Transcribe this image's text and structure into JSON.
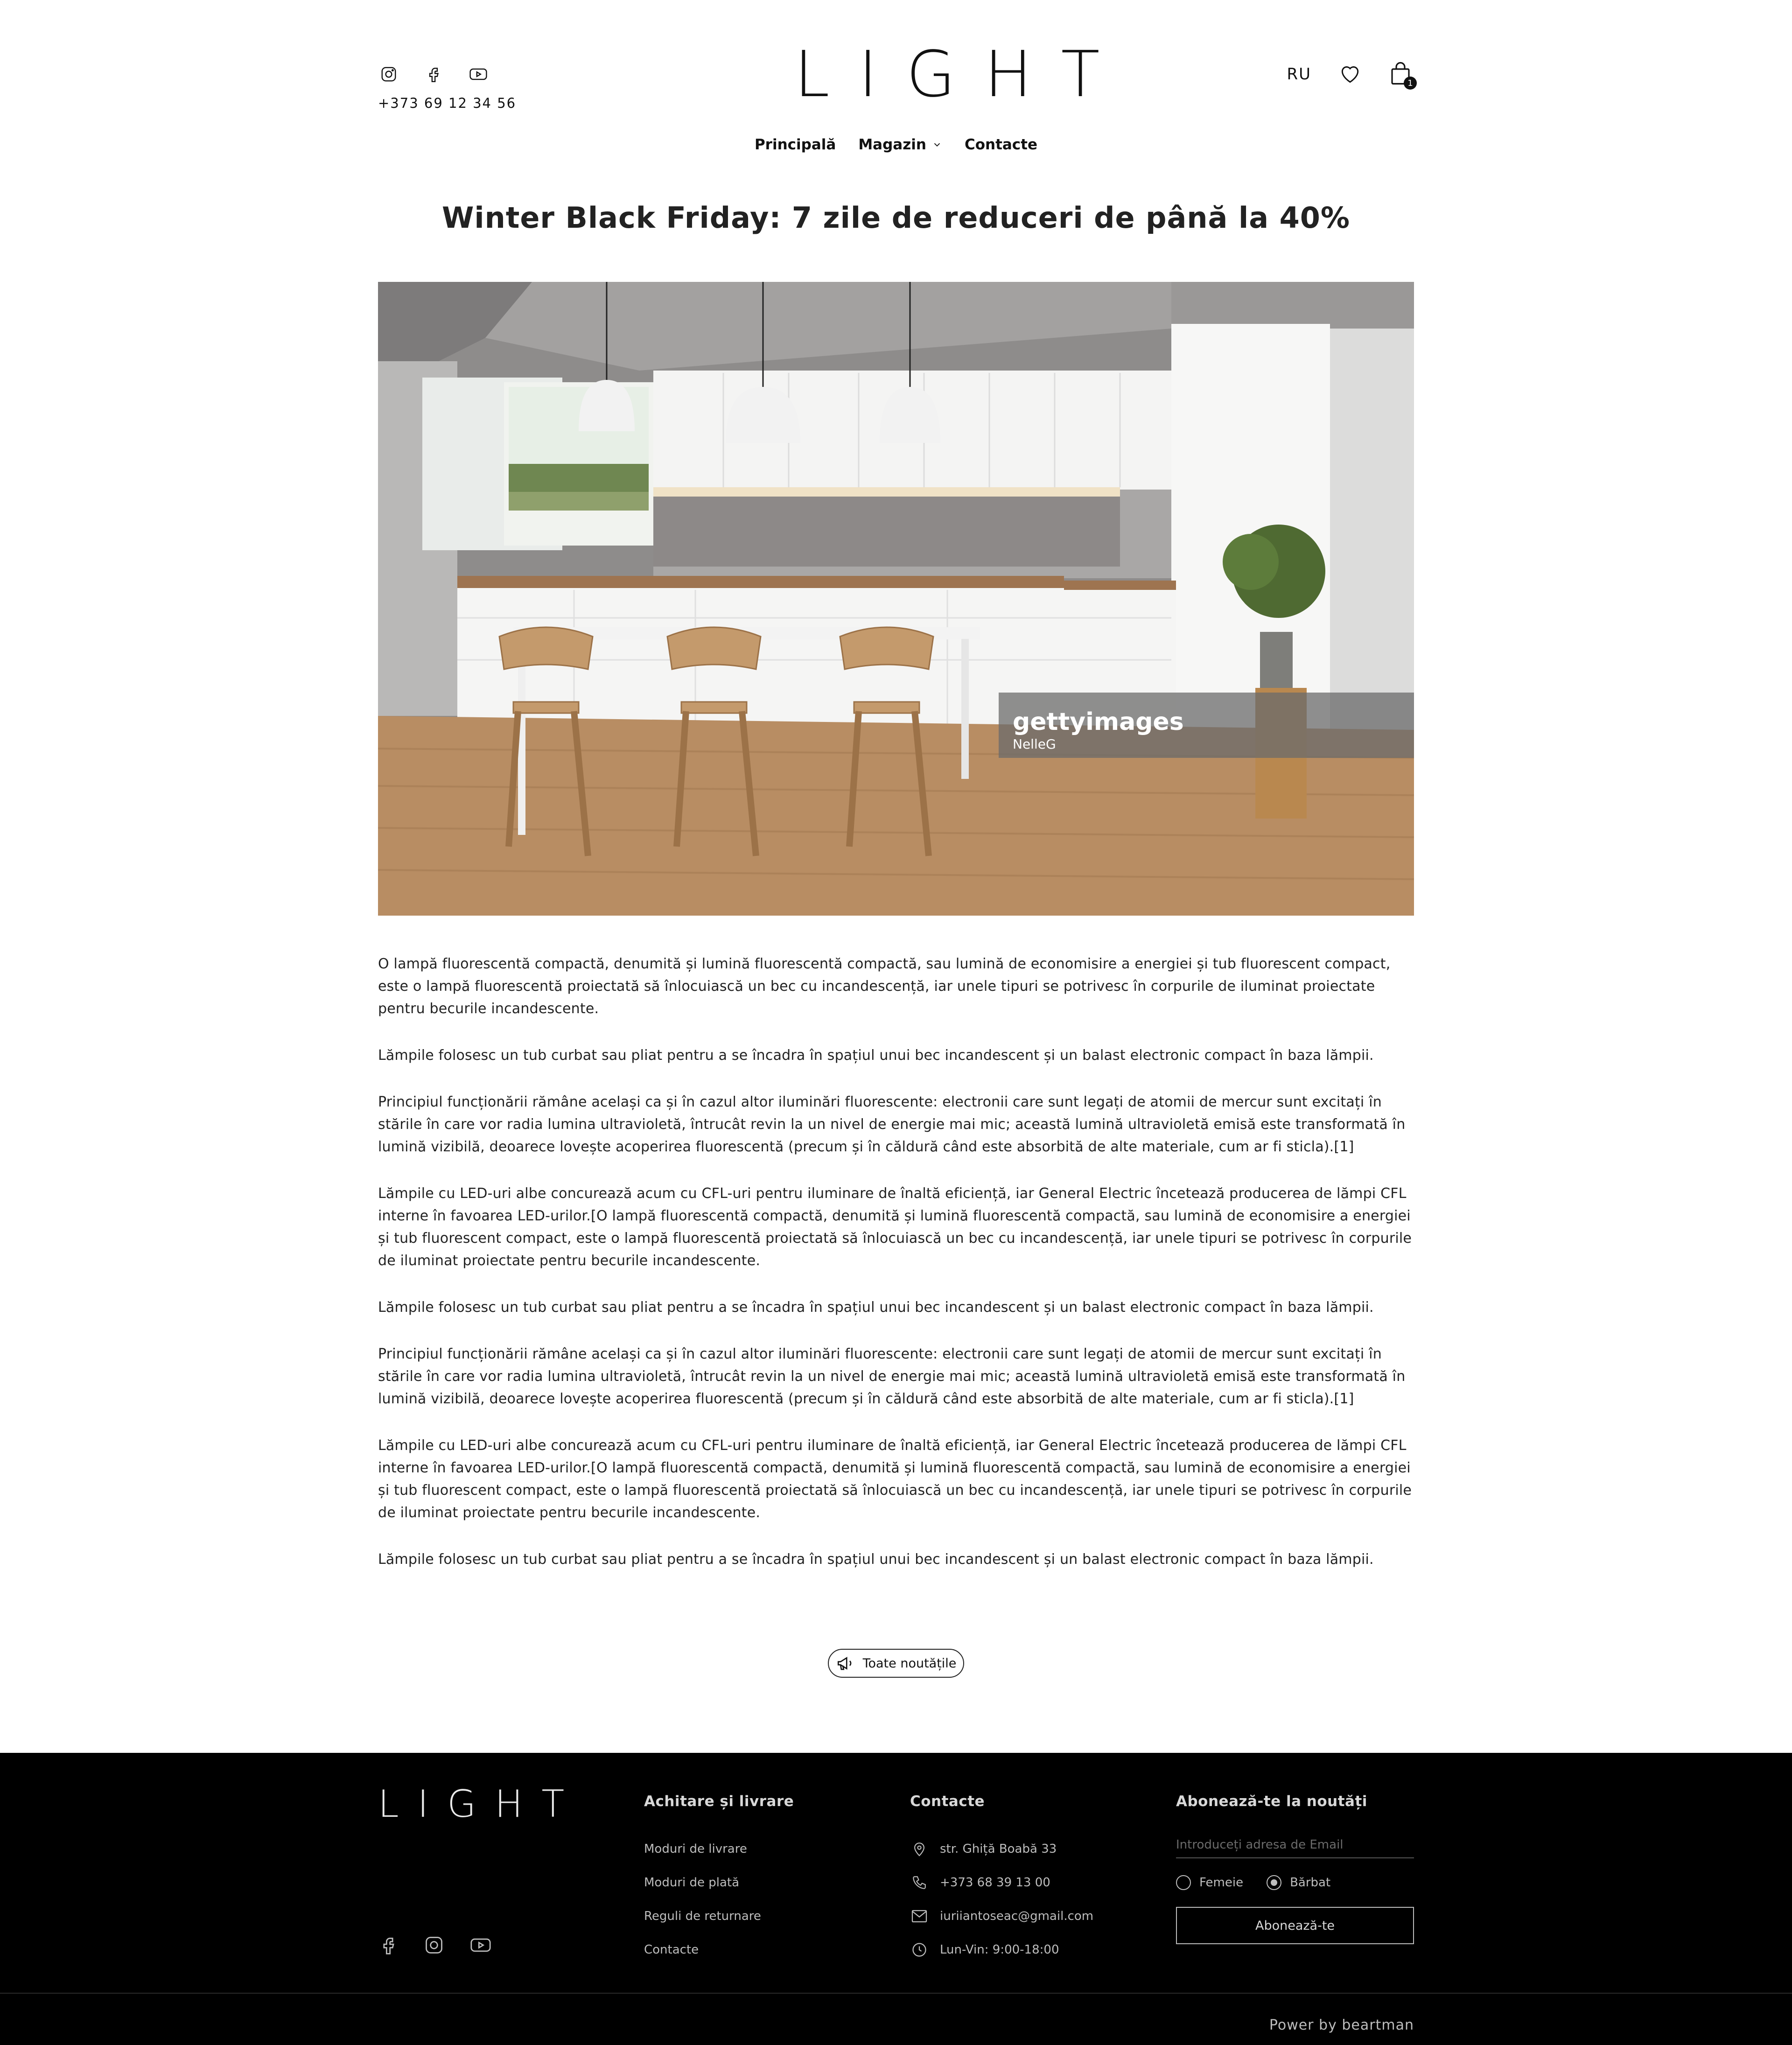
{
  "header": {
    "phone": "+373 69 12 34 56",
    "logo": "LIGHT",
    "lang": "RU",
    "cart_count": "1",
    "social_icons": [
      "instagram-icon",
      "facebook-icon",
      "youtube-icon"
    ]
  },
  "nav": {
    "home": "Principală",
    "shop": "Magazin",
    "contacts": "Contacte"
  },
  "article": {
    "title": "Winter Black Friday: 7 zile de reduceri de până la 40%",
    "image_watermark": {
      "brand": "gettyimages",
      "author": "NelleG"
    },
    "paragraphs": [
      "O lampă fluorescentă compactă, denumită și lumină fluorescentă compactă, sau lumină de economisire a energiei și tub fluorescent compact, este o lampă fluorescentă proiectată să înlocuiască un bec cu incandescență, iar unele tipuri se potrivesc în corpurile de iluminat proiectate pentru becurile incandescente.",
      "Lămpile folosesc un tub curbat sau pliat pentru a se încadra în spațiul unui bec incandescent și un balast electronic compact în baza lămpii.",
      "Principiul funcționării rămâne același ca și în cazul altor iluminări fluorescente: electronii care sunt legați de atomii de mercur sunt excitați în stările în care vor radia lumina ultravioletă, întrucât revin la un nivel de energie mai mic; această lumină ultravioletă emisă este transformată în lumină vizibilă, deoarece lovește acoperirea fluorescentă (precum și în căldură când este absorbită de alte materiale, cum ar fi sticla).[1]",
      "Lămpile cu LED-uri albe concurează acum cu CFL-uri pentru iluminare de înaltă eficiență, iar General Electric încetează producerea de lămpi CFL interne în favoarea LED-urilor.[O lampă fluorescentă compactă, denumită și lumină fluorescentă compactă, sau lumină de economisire a energiei și tub fluorescent compact, este o lampă fluorescentă proiectată să înlocuiască un bec cu incandescență, iar unele tipuri se potrivesc în corpurile de iluminat proiectate pentru becurile incandescente.",
      "Lămpile folosesc un tub curbat sau pliat pentru a se încadra în spațiul unui bec incandescent și un balast electronic compact în baza lămpii.",
      "Principiul funcționării rămâne același ca și în cazul altor iluminări fluorescente: electronii care sunt legați de atomii de mercur sunt excitați în stările în care vor radia lumina ultravioletă, întrucât revin la un nivel de energie mai mic; această lumină ultravioletă emisă este transformată în lumină vizibilă, deoarece lovește acoperirea fluorescentă (precum și în căldură când este absorbită de alte materiale, cum ar fi sticla).[1]",
      "Lămpile cu LED-uri albe concurează acum cu CFL-uri pentru iluminare de înaltă eficiență, iar General Electric încetează producerea de lămpi CFL interne în favoarea LED-urilor.[O lampă fluorescentă compactă, denumită și lumină fluorescentă compactă, sau lumină de economisire a energiei și tub fluorescent compact, este o lampă fluorescentă proiectată să înlocuiască un bec cu incandescență, iar unele tipuri se potrivesc în corpurile de iluminat proiectate pentru becurile incandescente.",
      "Lămpile folosesc un tub curbat sau pliat pentru a se încadra în spațiul unui bec incandescent și un balast electronic compact în baza lămpii."
    ],
    "all_news_label": "Toate noutățile"
  },
  "footer": {
    "logo": "LIGHT",
    "payment": {
      "title": "Achitare și livrare",
      "links": [
        "Moduri de livrare",
        "Moduri de plată",
        "Reguli de returnare",
        "Contacte"
      ]
    },
    "contacts": {
      "title": "Contacte",
      "address": "str. Ghiță Boabă 33",
      "phone": "+373 68 39 13 00",
      "email": "iuriiantoseac@gmail.com",
      "hours": "Lun-Vin: 9:00-18:00"
    },
    "newsletter": {
      "title": "Abonează-te la noutăți",
      "placeholder": "Introduceți adresa de Email",
      "female": "Femeie",
      "male": "Bărbat",
      "selected": "male",
      "button": "Abonează-te"
    },
    "power": "Power by beartman"
  },
  "colors": {
    "footer_bg": "#000000",
    "text": "#1a1a1a"
  }
}
